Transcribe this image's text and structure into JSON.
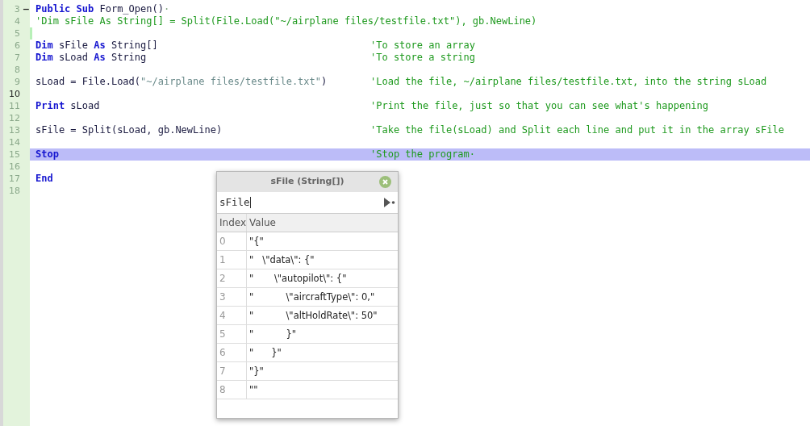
{
  "editor": {
    "lines": [
      {
        "number": "3",
        "fold": "−",
        "tokens": [
          {
            "kind": "keyword",
            "text": "Public Sub"
          },
          {
            "kind": "plain",
            "text": " Form_Open()"
          },
          {
            "kind": "marker",
            "text": "·"
          }
        ]
      },
      {
        "number": "4",
        "tokens": [
          {
            "kind": "comment",
            "text": "'Dim sFile As String[] = Split(File.Load(\"~/airplane files/testfile.txt\"), gb.NewLine)"
          }
        ]
      },
      {
        "number": "5",
        "modified": true
      },
      {
        "number": "6",
        "tokens": [
          {
            "kind": "keyword",
            "text": "Dim"
          },
          {
            "kind": "plain",
            "text": " sFile "
          },
          {
            "kind": "keyword",
            "text": "As"
          },
          {
            "kind": "plain",
            "text": " String[]"
          }
        ],
        "comment": "'To store an array"
      },
      {
        "number": "7",
        "tokens": [
          {
            "kind": "keyword",
            "text": "Dim"
          },
          {
            "kind": "plain",
            "text": " sLoad "
          },
          {
            "kind": "keyword",
            "text": "As"
          },
          {
            "kind": "plain",
            "text": " String"
          }
        ],
        "comment": "'To store a string"
      },
      {
        "number": "8"
      },
      {
        "number": "9",
        "tokens": [
          {
            "kind": "plain",
            "text": "sLoad = File.Load("
          },
          {
            "kind": "string",
            "text": "\"~/airplane files/testfile.txt\""
          },
          {
            "kind": "plain",
            "text": ")"
          }
        ],
        "comment": "'Load the file, ~/airplane files/testfile.txt, into the string sLoad"
      },
      {
        "number": "10",
        "current": true
      },
      {
        "number": "11",
        "tokens": [
          {
            "kind": "keyword",
            "text": "Print"
          },
          {
            "kind": "plain",
            "text": " sLoad"
          }
        ],
        "comment": "'Print the file, just so that you can see what's happening"
      },
      {
        "number": "12"
      },
      {
        "number": "13",
        "tokens": [
          {
            "kind": "plain",
            "text": "sFile = Split(sLoad, gb.NewLine)"
          }
        ],
        "comment": "'Take the file(sLoad) and Split each line and put it in the array sFile"
      },
      {
        "number": "14"
      },
      {
        "number": "15",
        "highlighted": true,
        "tokens": [
          {
            "kind": "keyword",
            "text": "Stop"
          }
        ],
        "comment": "'Stop the program·"
      },
      {
        "number": "16"
      },
      {
        "number": "17",
        "tokens": [
          {
            "kind": "keyword",
            "text": "End"
          }
        ]
      },
      {
        "number": "18"
      }
    ]
  },
  "watch_popup": {
    "title": "sFile (String[])",
    "expression": "sFile",
    "columns": [
      "Index",
      "Value"
    ],
    "rows": [
      {
        "index": "0",
        "value": "\"{\""
      },
      {
        "index": "1",
        "value": "\"   \\\"data\\\": {\""
      },
      {
        "index": "2",
        "value": "\"       \\\"autopilot\\\": {\""
      },
      {
        "index": "3",
        "value": "\"           \\\"aircraftType\\\": 0,\""
      },
      {
        "index": "4",
        "value": "\"           \\\"altHoldRate\\\": 50\""
      },
      {
        "index": "5",
        "value": "\"           }\""
      },
      {
        "index": "6",
        "value": "\"      }\""
      },
      {
        "index": "7",
        "value": "\"}\""
      },
      {
        "index": "8",
        "value": "\"\""
      }
    ]
  }
}
